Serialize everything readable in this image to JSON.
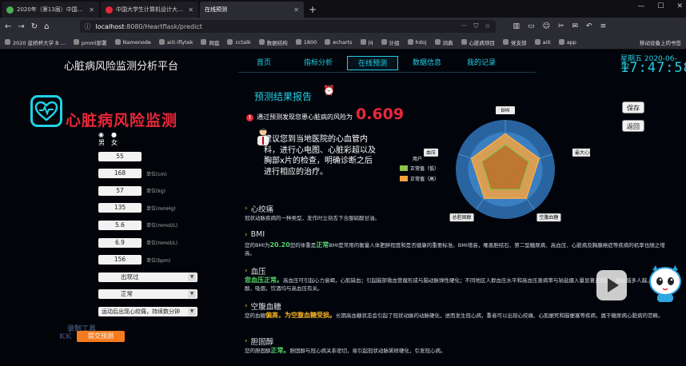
{
  "browser": {
    "tabs": [
      {
        "label": "2020年（第13届）中国大学生",
        "color": "#4caf50",
        "active": false
      },
      {
        "label": "中国大学生计算机设计大赛 -",
        "color": "#e8283a",
        "active": false
      },
      {
        "label": "在线预测",
        "color": "#2b2b33",
        "active": true
      }
    ],
    "url_host": "localhost",
    "url_path": ":8080/Heartflask/predict",
    "bookmarks": [
      "2020 蓝桥杯大学 B ...",
      "pmml部署",
      "Namenode",
      "aiit-iflytek",
      "网盘",
      "cctalk",
      "数据结构",
      "1800",
      "echarts",
      "jq",
      "计组",
      "hdoj",
      "词典",
      "心脏病项目",
      "党支部",
      "aiit",
      "app"
    ],
    "bookmarks_right": "移动设备上的书签"
  },
  "left": {
    "platform_title": "心脏病风险监测分析平台",
    "logo_title": "心脏病风险监测",
    "gender_label": "性别",
    "gender_options": {
      "male": "男",
      "female": "女"
    },
    "fields": [
      {
        "label": "年龄",
        "value": "55",
        "unit": ""
      },
      {
        "label": "身高",
        "value": "168",
        "unit": "单位(cm)"
      },
      {
        "label": "体重",
        "value": "57",
        "unit": "单位(kg)"
      },
      {
        "label": "血压高压",
        "value": "135",
        "unit": "单位(mmHg)"
      },
      {
        "label": "总胆固醇",
        "value": "5.6",
        "unit": "单位(mmol/L)"
      },
      {
        "label": "空腹血糖",
        "value": "6.9",
        "unit": "单位(mmol/L)"
      },
      {
        "label": "运动时最大心率",
        "value": "156",
        "unit": "单位(bpm)"
      }
    ],
    "selects": [
      {
        "label": "运动引发心绞痛",
        "value": "出现过"
      },
      {
        "label": "患地中海贫血",
        "value": "正常"
      },
      {
        "label": "胸痛症状",
        "value": "运动后出现心绞痛，持续数分钟"
      }
    ],
    "watermark": "录制工具",
    "watermark2": "KK",
    "submit_label": "提交预测"
  },
  "nav": {
    "items": [
      "首页",
      "指标分析",
      "在线预测",
      "数据信息",
      "我的记录"
    ],
    "active": "在线预测",
    "weekday_date": "星期五 2020-06-12",
    "time": "17:47:58"
  },
  "result": {
    "title": "预测结果报告",
    "risk_text": "通过预测发现您患心脏病的风险为",
    "risk_value": "0.609",
    "advice": "建议您到当地医院的心血管内科，进行心电图、心脏彩超以及胸部x片的检查，明确诊断之后进行相应的治疗。",
    "save_label": "保存",
    "back_label": "返回"
  },
  "chart_data": {
    "type": "radar",
    "indicators": [
      "BMI",
      "最大心率",
      "空腹血糖",
      "总胆固醇",
      "血压"
    ],
    "legend_title": "用户",
    "series": [
      {
        "name": "正常值（低）",
        "color": "#8bc34a"
      },
      {
        "name": "正常值（高）",
        "color": "#f4a340"
      }
    ]
  },
  "sections": [
    {
      "title": "心绞痛",
      "body": "冠状动脉疾病的一种类型，发作时立刻舌下含服硝酸甘油。"
    },
    {
      "title": "BMI",
      "pre": "您的BMI为",
      "highlight": "20.20",
      "mid": "您的体重是",
      "highlight2": "正常",
      "body": "BMI是常用的衡量人体肥胖程度和是否健康的重要标准。BMI增高，罹患胆结石、第二型糖尿病、高血压、心脏病及胸腺癌症等疾病的机率也随之增高。"
    },
    {
      "title": "血压",
      "pre": "您血压正常。",
      "body": "高血压可引起心力衰竭，心肌缺血；引起脑部微血管瘤形成与脑动脉弹性硬化；不同地区人群血压水平和高血压患病率与钠盐摄入量显著正相关。摄盐越多人越，叶酸，吸烟，饮酒均与高血压有关。"
    },
    {
      "title": "空腹血糖",
      "pre": "您的血糖",
      "highlight": "偏高，为空腹血糖受损。",
      "body": "长期高血糖状态会引起了冠状动脉的动脉硬化，进而发生冠心病，重者可以出现心绞痛、心肌梗死和脑梗塞等疾病，属于糖尿病心脏病的范畴。"
    },
    {
      "title": "胆固醇",
      "pre": "您的胆固醇",
      "highlight": "正常。",
      "body": "胆固醇与冠心病关系密切，易引起冠状动脉粥样硬化，引发冠心病。"
    }
  ]
}
